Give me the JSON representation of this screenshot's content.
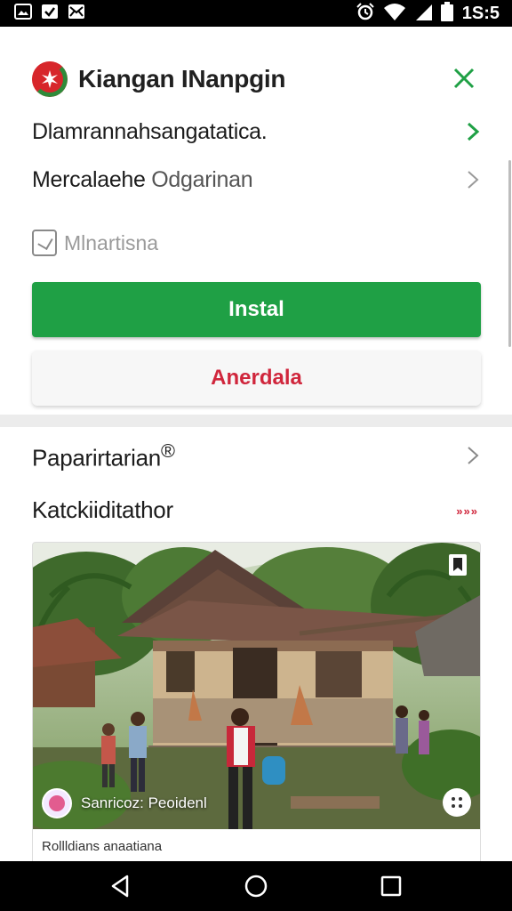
{
  "status_bar": {
    "time": "1S:5",
    "left_icons": [
      "gallery-icon",
      "check-box-icon",
      "email-icon"
    ],
    "right_icons": [
      "alarm-icon",
      "wifi-icon",
      "signal-icon",
      "battery-icon"
    ]
  },
  "header": {
    "title": "Kiangan INanpgin",
    "logo_icon": "app-logo-icon",
    "close_icon": "close-icon"
  },
  "rows": [
    {
      "text": "Dlamrannahsangatatica."
    },
    {
      "text_dark": "Mercalaehe ",
      "text_muted": "Odgarinan"
    }
  ],
  "meta": {
    "label": "Mlnartisna"
  },
  "buttons": {
    "install_label": "Instal",
    "secondary_label": "Anerdala"
  },
  "sections": {
    "first_title": "Paparirtarian",
    "first_mark": "®",
    "second_title": "Katckiiditathor",
    "more_label": "»»»"
  },
  "photo_card": {
    "overlay_text": "Sanricoz: Peoidenl",
    "caption": "Rollldians anaatiana"
  },
  "colors": {
    "install": "#1fa045",
    "secondary_text": "#d0263c",
    "chevron_green": "#1fa045"
  }
}
